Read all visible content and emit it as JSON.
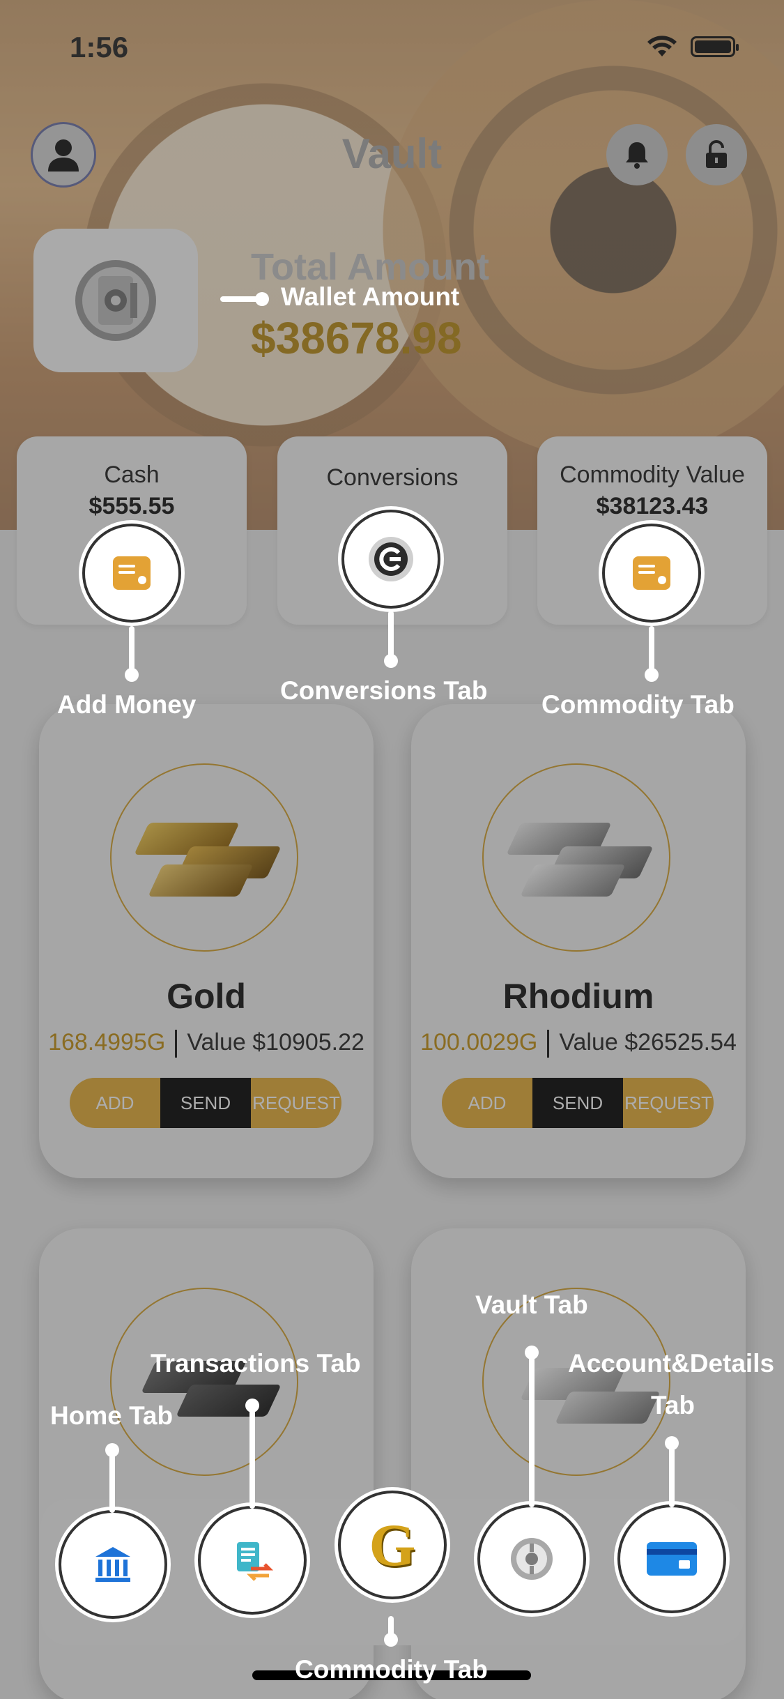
{
  "status_bar": {
    "time": "1:56"
  },
  "header": {
    "title": "Vault"
  },
  "balance": {
    "label": "Total Amount",
    "value": "$38678.98"
  },
  "summary_cards": [
    {
      "label": "Cash",
      "value": "$555.55"
    },
    {
      "label": "Conversions",
      "value": ""
    },
    {
      "label": "Commodity Value",
      "value": "$38123.43"
    }
  ],
  "commodities": [
    {
      "name": "Gold",
      "amount": "168.4995G",
      "value": "Value $10905.22",
      "actions": [
        "ADD",
        "SEND",
        "REQUEST"
      ]
    },
    {
      "name": "Rhodium",
      "amount": "100.0029G",
      "value": "Value $26525.54",
      "actions": [
        "ADD",
        "SEND",
        "REQUEST"
      ]
    }
  ],
  "tab_bar": {
    "center_glyph": "G"
  },
  "annotations": {
    "wallet_amount": "Wallet Amount",
    "add_money": "Add Money",
    "conversions_tab": "Conversions Tab",
    "commodity_tab_top": "Commodity Tab",
    "home_tab": "Home Tab",
    "transactions_tab": "Transactions Tab",
    "vault_tab": "Vault Tab",
    "account_details_line1": "Account&Details",
    "account_details_line2": "Tab",
    "commodity_tab_bottom": "Commodity Tab"
  },
  "colors": {
    "accent_gold": "#e5ac35",
    "amount_gold": "#c38f11",
    "overlay": "#3c3c3c"
  },
  "icons": [
    "user-icon",
    "bell-icon",
    "unlock-icon",
    "vault-door-icon",
    "wallet-icon",
    "conversion-icon",
    "gold-bars-icon",
    "rhodium-bars-icon",
    "bank-icon",
    "transactions-icon",
    "commodity-g-icon",
    "vault-icon",
    "credit-card-icon"
  ]
}
